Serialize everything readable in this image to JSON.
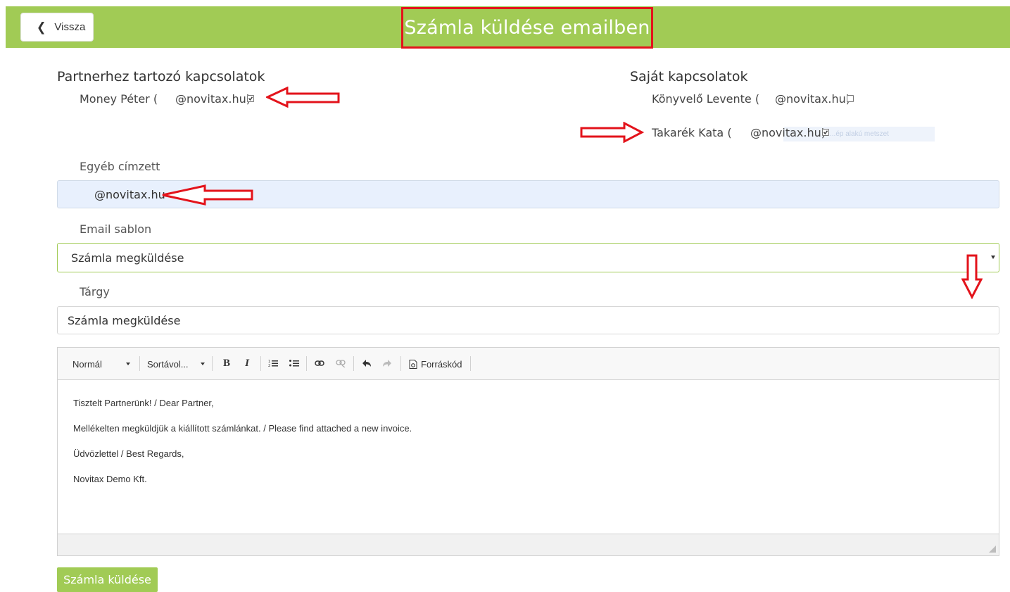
{
  "header": {
    "back_label": "Vissza",
    "title": "Számla küldése emailben",
    "bar_color": "#a1cb55",
    "highlight_color": "#e3131b"
  },
  "partner_contacts": {
    "heading": "Partnerhez tartozó kapcsolatok",
    "items": [
      {
        "name": "Money Péter (",
        "email": "@novitax.hu)",
        "checked": true
      }
    ]
  },
  "own_contacts": {
    "heading": "Saját kapcsolatok",
    "items": [
      {
        "name": "Könyvelő Levente (",
        "email": "@novitax.hu)",
        "checked": false
      },
      {
        "name": "Takarék Kata (",
        "email": "@novitax.hu)",
        "checked": true
      }
    ],
    "ghost_text": "...ép alakú metszet"
  },
  "other_recipient": {
    "label": "Egyéb címzett",
    "value": "@novitax.hu"
  },
  "email_template": {
    "label": "Email sablon",
    "selected": "Számla megküldése"
  },
  "subject": {
    "label": "Tárgy",
    "value": "Számla megküldése"
  },
  "editor": {
    "toolbar": {
      "format": "Normál",
      "line_spacing": "Sortávol...",
      "bold": "B",
      "italic": "I",
      "source": "Forráskód"
    },
    "body": [
      "Tisztelt Partnerünk! / Dear Partner,",
      "Mellékelten megküldjük a kiállított számlánkat. / Please find attached a new invoice.",
      "Üdvözlettel / Best Regards,",
      "Novitax Demo Kft."
    ]
  },
  "send_label": "Számla küldése"
}
